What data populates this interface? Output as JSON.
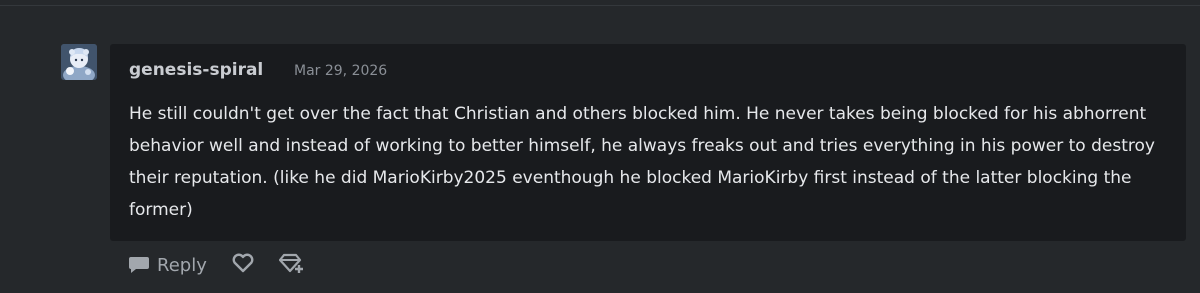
{
  "comment": {
    "username": "genesis-spiral",
    "timestamp": "Mar 29, 2026",
    "body": "He still couldn't get over the fact that Christian and others blocked him. He never takes being blocked for his abhorrent behavior well and instead of working to better himself, he always freaks out and tries everything in his power to destroy their reputation. (like he did MarioKirby2025 eventhough he blocked MarioKirby first instead of the latter blocking the former)",
    "avatar_icon": "user-avatar"
  },
  "actions": {
    "reply_label": "Reply",
    "reply_icon": "speech-bubble-icon",
    "like_icon": "heart-icon",
    "award_icon": "gem-plus-icon"
  },
  "colors": {
    "page_background": "#25282b",
    "comment_background": "#191b1e",
    "text": "#e6e8eb",
    "muted": "#8a8f96"
  }
}
